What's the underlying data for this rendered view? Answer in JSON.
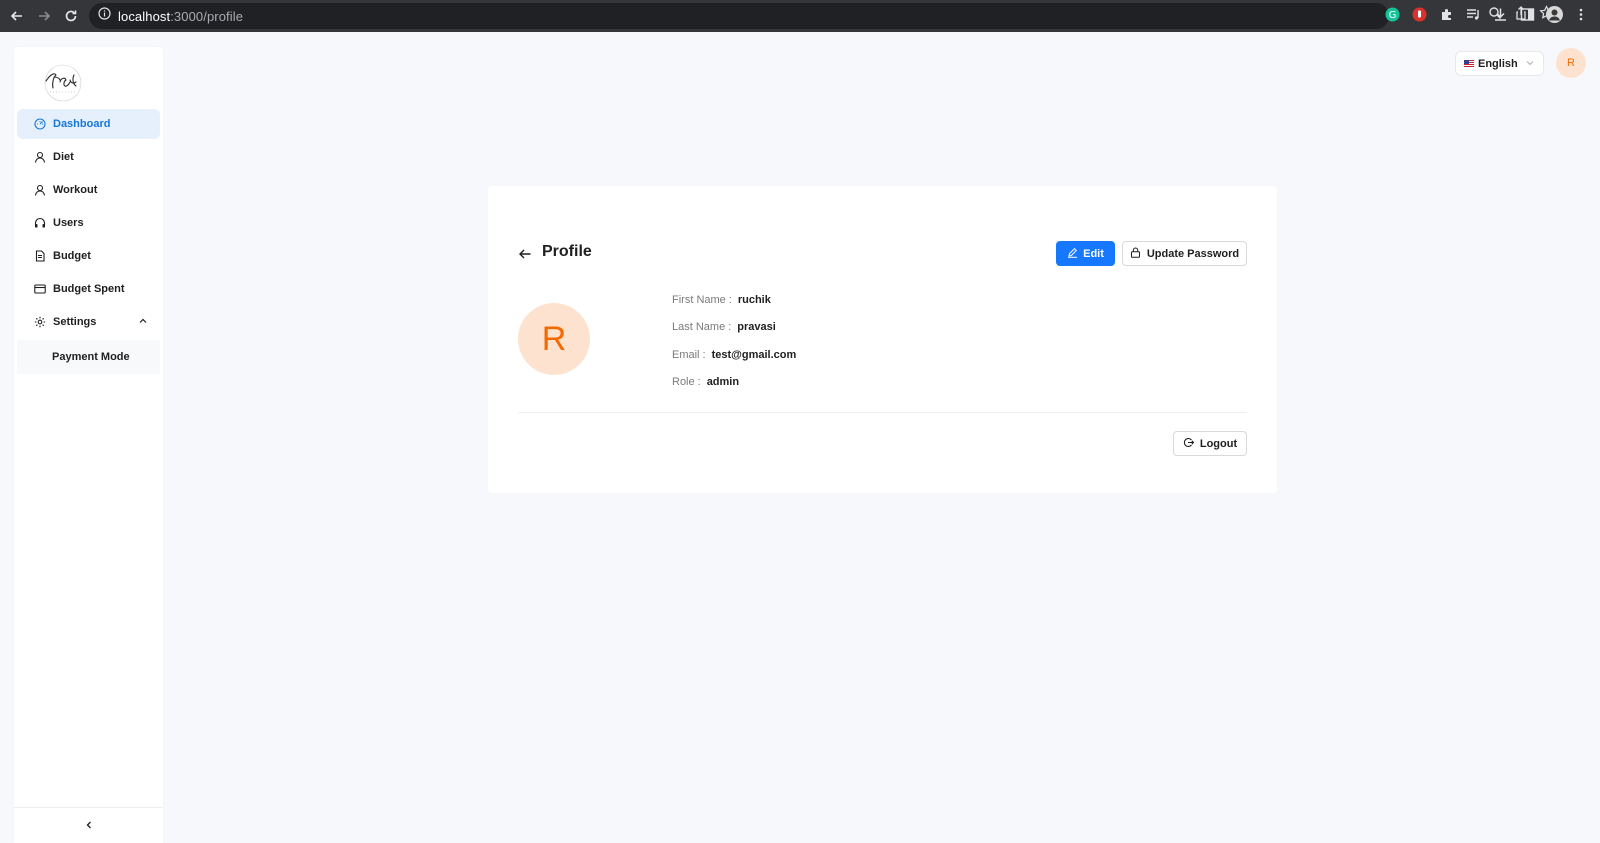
{
  "browser": {
    "url_host": "localhost",
    "url_path": ":3000/profile"
  },
  "sidebar": {
    "items": [
      {
        "label": "Dashboard",
        "icon": "dashboard-icon"
      },
      {
        "label": "Diet",
        "icon": "user-icon"
      },
      {
        "label": "Workout",
        "icon": "user-icon"
      },
      {
        "label": "Users",
        "icon": "headset-icon"
      },
      {
        "label": "Budget",
        "icon": "file-icon"
      },
      {
        "label": "Budget Spent",
        "icon": "card-icon"
      },
      {
        "label": "Settings",
        "icon": "gear-icon"
      }
    ],
    "submenu": {
      "label": "Payment Mode"
    },
    "active_item": "Dashboard"
  },
  "header": {
    "language": "English",
    "avatar_initial": "R"
  },
  "profile": {
    "title": "Profile",
    "edit_label": "Edit",
    "update_password_label": "Update Password",
    "avatar_initial": "R",
    "fields": [
      {
        "key": "First Name",
        "value": "ruchik"
      },
      {
        "key": "Last Name",
        "value": "pravasi"
      },
      {
        "key": "Email",
        "value": "test@gmail.com"
      },
      {
        "key": "Role",
        "value": "admin"
      }
    ],
    "logout_label": "Logout"
  },
  "colors": {
    "primary": "#1677ff",
    "active_menu_bg": "#e6f0fc",
    "active_menu_text": "#1677d6",
    "avatar_bg": "#fde3cf",
    "avatar_text": "#f56a00"
  }
}
